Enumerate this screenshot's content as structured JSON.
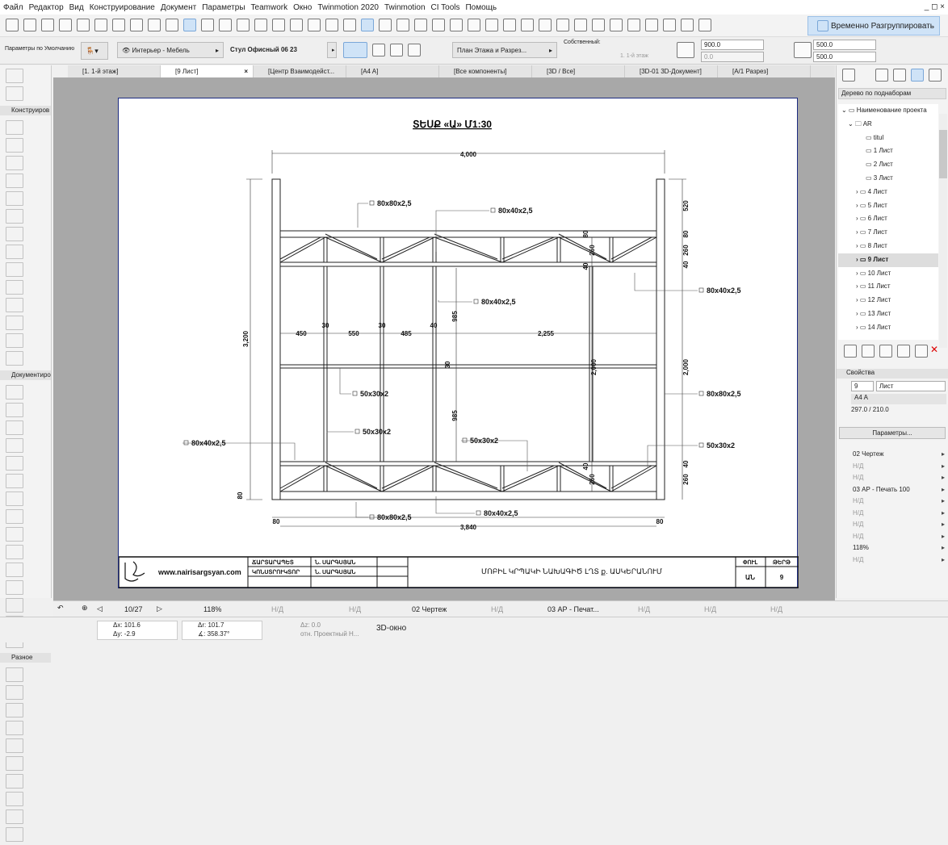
{
  "menu": [
    "Файл",
    "Редактор",
    "Вид",
    "Конструирование",
    "Документ",
    "Параметры",
    "Teamwork",
    "Окно",
    "Twinmotion 2020",
    "Twinmotion",
    "CI Tools",
    "Помощь"
  ],
  "window_controls": "_ ◻ ×",
  "toolbar": {
    "ungroup_label": "Временно Разгруппировать"
  },
  "info_box": {
    "preset": "Параметры по Умолчанию",
    "layer": "Интерьер - Мебель",
    "object": "Стул Офисный 06 23",
    "view": "План Этажа и Разрез...",
    "own_label": "Собственный:",
    "story": "1. 1-й этаж",
    "height1": "900.0",
    "height2": "0.0",
    "width": "500.0",
    "depth": "500.0"
  },
  "tabs": [
    {
      "label": "[1. 1-й этаж]"
    },
    {
      "label": "[9 Лист]",
      "active": true
    },
    {
      "label": "[Центр Взаимодейст..."
    },
    {
      "label": "[A4 A]"
    },
    {
      "label": "[Все компоненты]"
    },
    {
      "label": "[3D / Все]"
    },
    {
      "label": "[3D-01 3D-Документ]"
    },
    {
      "label": "[A/1 Разрез]"
    }
  ],
  "toolbox": {
    "sections": [
      "Конструиров",
      "Документиро",
      "Разное"
    ]
  },
  "drawing": {
    "title": "ՏԵՍՔ «Ա» Մ1:30",
    "dims": {
      "top": "4,000",
      "bottom": "3,840",
      "left": "3,200",
      "h1": "450",
      "h2": "30",
      "h3": "550",
      "h4": "30",
      "h5": "485",
      "h6": "40",
      "h7": "2,255",
      "r1": "520",
      "r2": "80",
      "r3": "260",
      "r4": "40",
      "r5": "2,000",
      "r6": "2,000",
      "r7": "40",
      "r8": "260",
      "b1": "80",
      "b2": "80",
      "lb": "80",
      "v1": "985",
      "v2": "30",
      "v3": "985",
      "v4": "2,000",
      "t80": "80",
      "t260": "260",
      "t40": "40",
      "bt40": "40",
      "bt260": "260"
    },
    "labels": [
      "80x80x2,5",
      "80x40x2,5",
      "80x40x2,5",
      "80x40x2,5",
      "50x30x2",
      "50x30x2",
      "80x40x2,5",
      "50x30x2",
      "80x80x2,5",
      "50x30x2",
      "80x80x2,5",
      "80x40x2,5"
    ]
  },
  "title_block": {
    "website": "www.nairisargsyan.com",
    "role1": "ՃԱՐՏԱՐԱՊԵՏ",
    "name1": "Ն. ՍԱՐԳՍՅԱՆ",
    "role2": "ԿՈՆՍՏՐՈՒԿՏՈՐ",
    "name2": "Ն. ՍԱՐԳՍՅԱՆ",
    "project": "ՄՈԲԻԼ ԿՐՊԱԿԻ ՆԱԽԱԳԻԾ ԼՂՏ ք. ԱՍԿԵՐԱՆՈՒՄ",
    "phase_h": "ՓՈՒԼ",
    "sheet_h": "ԹԵՐԹ",
    "phase": "ԱՆ",
    "sheet": "9"
  },
  "navigator": {
    "mode": "Дерево по поднаборам",
    "root": "Наименование проекта",
    "folder": "AR",
    "items": [
      "titul",
      "1 Лист",
      "2 Лист",
      "3 Лист",
      "4 Лист",
      "5 Лист",
      "6 Лист",
      "7 Лист",
      "8 Лист",
      "9 Лист",
      "10 Лист",
      "11 Лист",
      "12 Лист",
      "13 Лист",
      "14 Лист"
    ],
    "selected": "9 Лист"
  },
  "properties": {
    "header": "Свойства",
    "number": "9",
    "name": "Лист",
    "master": "A4 A",
    "size": "297.0 / 210.0",
    "params_button": "Параметры...",
    "rows": [
      {
        "t": "02 Чертеж",
        "on": true
      },
      {
        "t": "Н/Д"
      },
      {
        "t": "Н/Д"
      },
      {
        "t": "03 АР - Печать 100",
        "on": true
      },
      {
        "t": "Н/Д"
      },
      {
        "t": "Н/Д"
      },
      {
        "t": "Н/Д"
      },
      {
        "t": "Н/Д"
      },
      {
        "t": "118%",
        "on": true
      },
      {
        "t": "Н/Д"
      }
    ]
  },
  "nav_bar": {
    "page": "10/27",
    "zoom": "118%",
    "na1": "Н/Д",
    "na2": "Н/Д",
    "layers": "02 Чертеж",
    "na3": "Н/Д",
    "pen": "03 АР - Печат...",
    "na4": "Н/Д",
    "na5": "Н/Д",
    "na6": "Н/Д"
  },
  "coords": {
    "dx": "Δx: 101.6",
    "dy": "Δy: -2.9",
    "dr": "Δr: 101.7",
    "angle": "∡: 358.37°",
    "dz": "Δz: 0.0",
    "ref": "отн. Проектный Н...",
    "view3d": "3D-окно"
  }
}
